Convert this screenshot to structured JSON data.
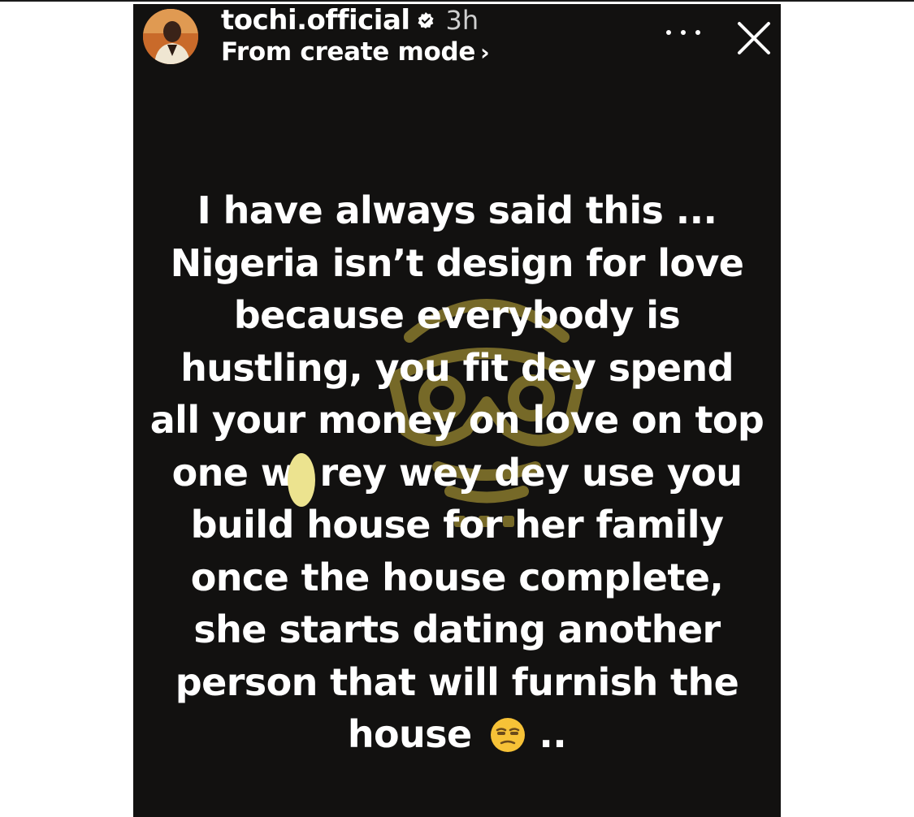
{
  "story": {
    "username": "tochi.official",
    "verified_icon": "verified-badge-icon",
    "time_ago": "3h",
    "subtitle": "From create mode",
    "subtitle_chevron": "›",
    "more_icon": "more-options-icon",
    "close_icon": "close-icon",
    "colors": {
      "background": "#121110",
      "text": "#ffffff",
      "watermark": "#c9b23c"
    },
    "caption_lines": [
      "I have always said this ...",
      "Nigeria isn’t design for love",
      "because everybody is",
      "hustling, you fit dey spend",
      "all your money on love on top",
      "one w  rey wey dey use you",
      "build house for her family",
      "once the house complete,",
      "she starts dating another",
      "person that will furnish the",
      "house"
    ],
    "caption_end": "..",
    "emoji": "unamused-face-emoji"
  }
}
